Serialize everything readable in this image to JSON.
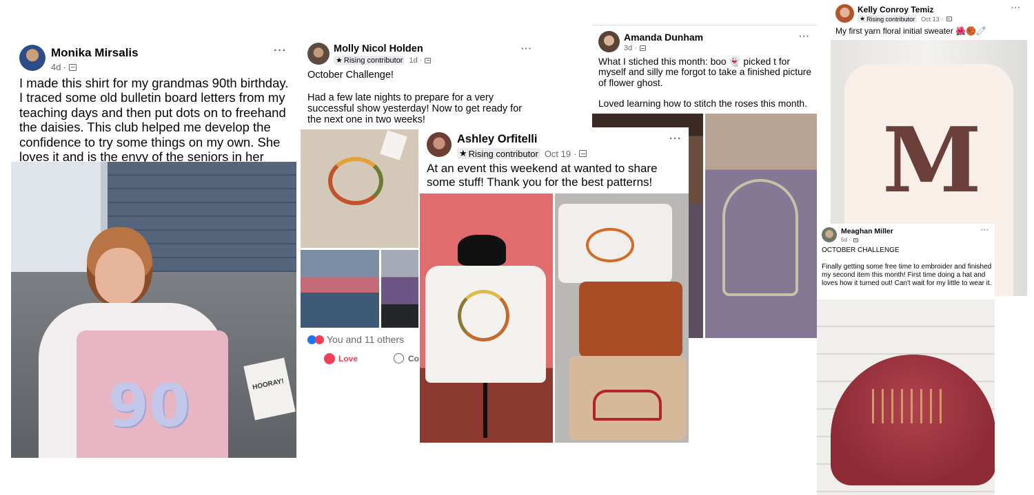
{
  "posts": {
    "monika": {
      "author": "Monika Mirsalis",
      "time": "4d",
      "sep": "·",
      "more": "···",
      "text": "I made this shirt for my grandmas 90th birthday. I traced some old bulletin board letters from my teaching days and then put dots on to freehand the daisies. This club helped me develop the confidence to try some things on my own. She loves it and is the envy of the seniors in her group.",
      "photo_text": "90",
      "bag_text": "HOORAY!"
    },
    "molly": {
      "author": "Molly Nicol Holden",
      "badge": "Rising contributor",
      "time": "1d",
      "sep": "·",
      "more": "···",
      "text": "October Challenge!\n\nHad a few late nights to prepare for a very successful show yesterday! Now to get ready for the next one in two weeks!",
      "reactions": "You and 11 others",
      "love_label": "Love",
      "comment_label": "Co"
    },
    "amanda": {
      "author": "Amanda Dunham",
      "time": "3d",
      "sep": "·",
      "more": "···",
      "text": "What I stiched this month: boo 👻 picked t for myself and silly me forgot to take a finished  picture of flower ghost.\n\nLoved learning how to stitch the roses this month."
    },
    "ashley": {
      "author": "Ashley Orfitelli",
      "badge": "Rising contributor",
      "time": "Oct 19",
      "sep": "·",
      "more": "···",
      "text": "At an event this weekend at wanted to share some stuff! Thank you for the best patterns!"
    },
    "kelly": {
      "author": "Kelly Conroy Temiz",
      "badge": "Rising contributor",
      "time": "Oct 13",
      "sep": "·",
      "more": "···",
      "text": "My first yarn floral initial sweater 🌺🏀🧷",
      "letter": "M"
    },
    "meaghan": {
      "author": "Meaghan Miller",
      "time": "5d",
      "sep": "·",
      "more": "···",
      "text": "OCTOBER CHALLENGE\n\nFinally getting some free time to embroider and finished my second item this month!  First time doing a hat and loves how it turned out!  Can't wait for my little to wear it."
    }
  },
  "icons": {
    "star": "★",
    "globe": "globe-icon",
    "like": "like-reaction-icon",
    "love": "love-reaction-icon",
    "comment": "comment-icon"
  },
  "colors": {
    "text": "#050505",
    "meta": "#65676b",
    "like_blue": "#1877f2",
    "love_red": "#f33e58"
  }
}
